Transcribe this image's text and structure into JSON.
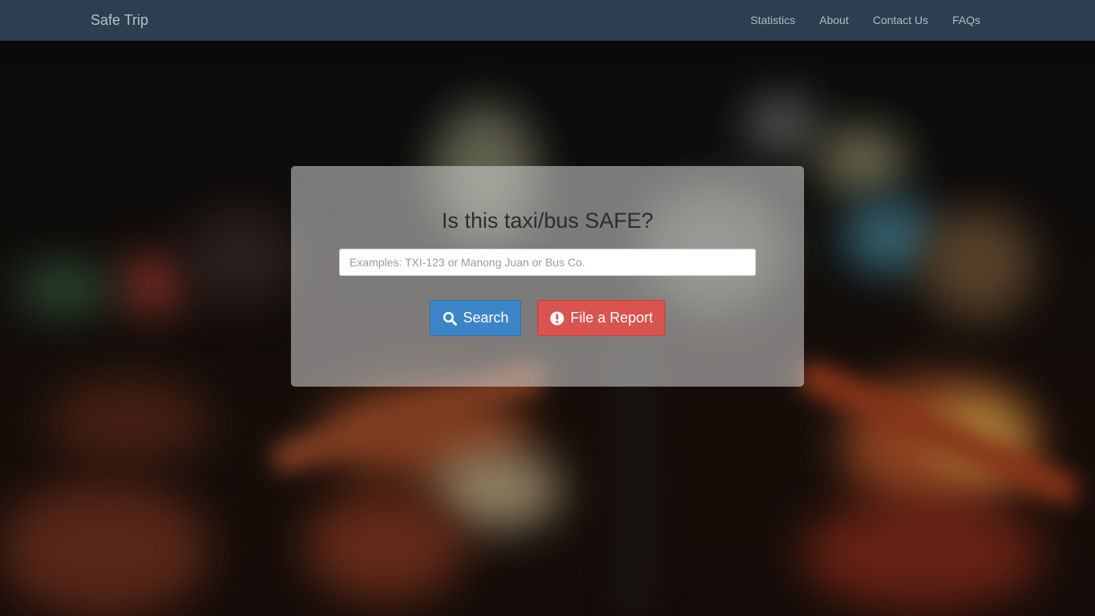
{
  "navbar": {
    "brand": "Safe Trip",
    "links": [
      {
        "label": "Statistics"
      },
      {
        "label": "About"
      },
      {
        "label": "Contact Us"
      },
      {
        "label": "FAQs"
      }
    ]
  },
  "hero": {
    "heading": "Is this taxi/bus SAFE?",
    "search": {
      "placeholder": "Examples: TXI-123 or Manong Juan or Bus Co.",
      "value": ""
    },
    "buttons": {
      "search_label": "Search",
      "search_icon": "search-icon",
      "report_label": "File a Report",
      "report_icon": "exclamation-circle-icon"
    }
  },
  "colors": {
    "navbar_bg": "#2c3e50",
    "search_button": "#3b84c8",
    "report_button": "#d9534f"
  }
}
